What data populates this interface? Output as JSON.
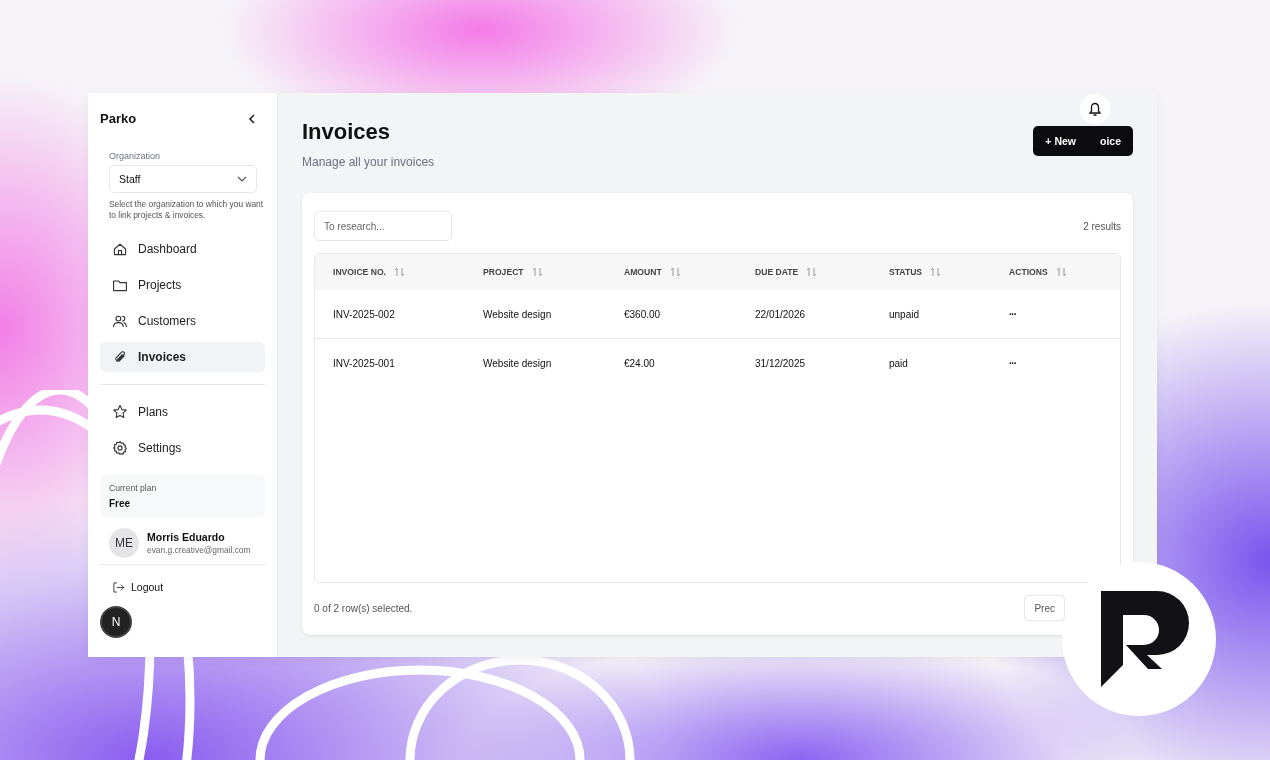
{
  "sidebar": {
    "brand": "Parko",
    "organization": {
      "label": "Organization",
      "value": "Staff",
      "help": "Select the organization to which you want to link projects & invoices."
    },
    "nav": [
      {
        "label": "Dashboard",
        "selected": false
      },
      {
        "label": "Projects",
        "selected": false
      },
      {
        "label": "Customers",
        "selected": false
      },
      {
        "label": "Invoices",
        "selected": true
      }
    ],
    "nav_secondary": [
      {
        "label": "Plans",
        "selected": false
      },
      {
        "label": "Settings",
        "selected": false
      }
    ],
    "plan": {
      "label": "Current plan",
      "value": "Free"
    },
    "user": {
      "initials": "ME",
      "name": "Morris Eduardo",
      "email": "evan.g.creative@gmail.com"
    },
    "logout": "Logout",
    "badge": "N"
  },
  "main": {
    "title": "Invoices",
    "subtitle": "Manage all your invoices",
    "new_button": [
      "+ New",
      "oice"
    ],
    "search": {
      "placeholder": "To research..."
    },
    "results": "2 results",
    "table": {
      "columns": [
        "INVOICE NO.",
        "PROJECT",
        "AMOUNT",
        "DUE DATE",
        "STATUS",
        "ACTIONS"
      ],
      "rows": [
        [
          "INV-2025-002",
          "Website design",
          "€360.00",
          "22/01/2026",
          "unpaid",
          "···"
        ],
        [
          "INV-2025-001",
          "Website design",
          "€24.00",
          "31/12/2025",
          "paid",
          "···"
        ]
      ]
    },
    "selection": "0 of 2 row(s) selected.",
    "prev_button": "Prec"
  }
}
